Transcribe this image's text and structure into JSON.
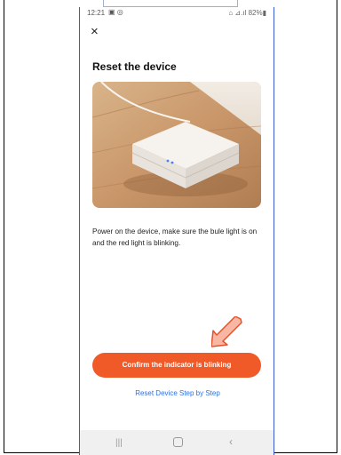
{
  "status_bar": {
    "time": "12:21",
    "right": "⌂ ⊿.ıl 82%▮"
  },
  "page": {
    "title": "Reset the device",
    "description": "Power on the device, make sure the bule light is on and the red light is blinking.",
    "primary_button": "Confirm the indicator is blinking",
    "secondary_link": "Reset Device Step by Step"
  },
  "icons": {
    "close": "×",
    "recents": "|||",
    "back": "‹"
  },
  "colors": {
    "accent": "#f05a28",
    "link": "#2f6fe0"
  }
}
